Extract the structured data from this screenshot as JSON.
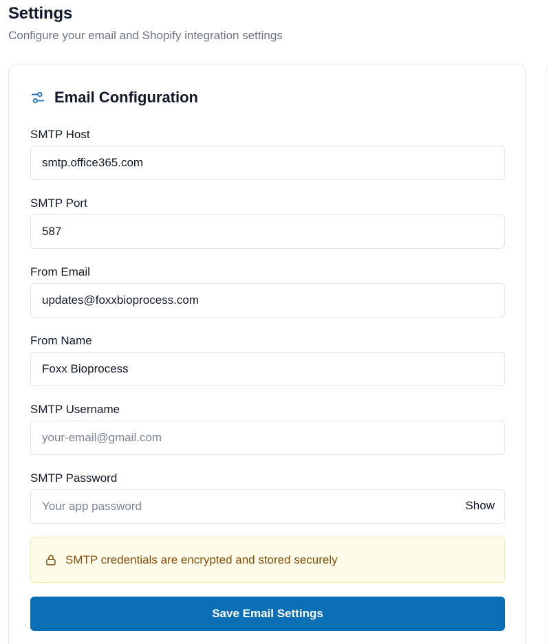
{
  "page": {
    "title": "Settings",
    "subtitle": "Configure your email and Shopify integration settings"
  },
  "email_card": {
    "title": "Email Configuration",
    "header_icon": "sliders-icon",
    "fields": [
      {
        "label": "SMTP Host",
        "value": "smtp.office365.com",
        "placeholder": ""
      },
      {
        "label": "SMTP Port",
        "value": "587",
        "placeholder": ""
      },
      {
        "label": "From Email",
        "value": "updates@foxxbioprocess.com",
        "placeholder": ""
      },
      {
        "label": "From Name",
        "value": "Foxx Bioprocess",
        "placeholder": ""
      },
      {
        "label": "SMTP Username",
        "value": "",
        "placeholder": "your-email@gmail.com"
      },
      {
        "label": "SMTP Password",
        "value": "",
        "placeholder": "Your app password",
        "toggle_label": "Show"
      }
    ],
    "notice": {
      "icon": "lock-icon",
      "text": "SMTP credentials are encrypted and stored securely"
    },
    "save_label": "Save Email Settings"
  },
  "colors": {
    "accent": "#0b6fb6",
    "notice_bg": "#fefce8",
    "notice_text": "#854d0e",
    "muted_text": "#6b7280"
  }
}
